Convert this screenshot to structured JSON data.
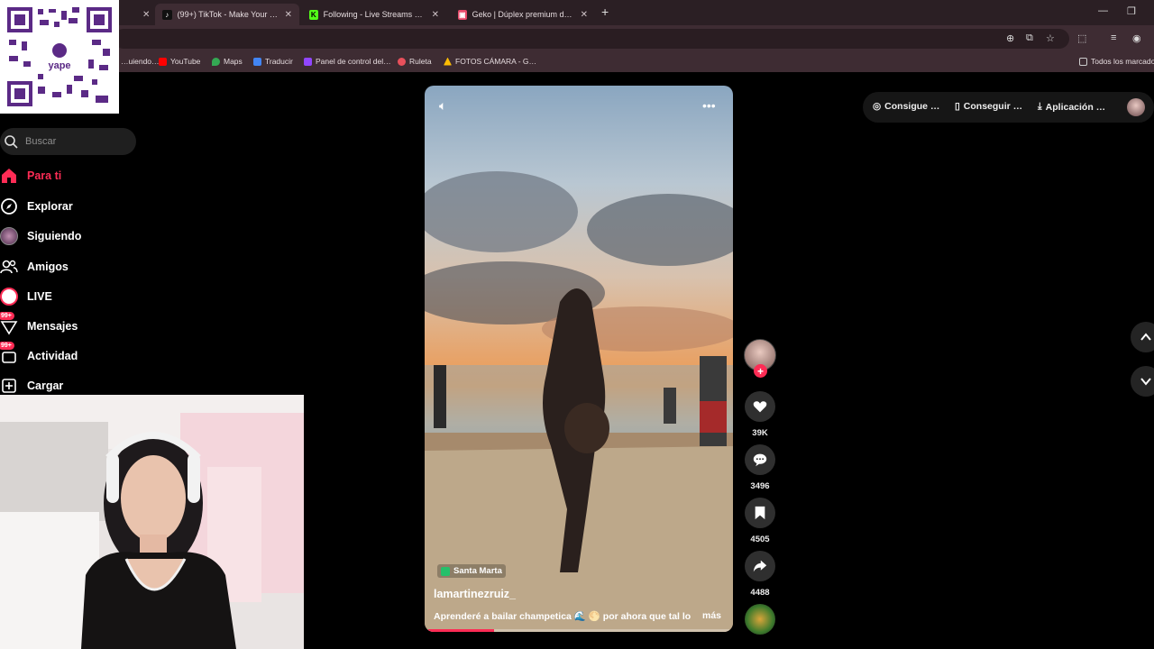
{
  "browser": {
    "tabs": [
      {
        "label": "(99+) TikTok - Make Your D…",
        "active": true
      },
      {
        "label": "Following - Live Streams on Ki…"
      },
      {
        "label": "Geko | Dúplex premium de 2 d…"
      }
    ],
    "bookmarks": [
      "…uiendo…",
      "YouTube",
      "Maps",
      "Traducir",
      "Panel de control del…",
      "Ruleta",
      "FOTOS CÁMARA - G…"
    ],
    "all_bookmarks_label": "Todos los marcados"
  },
  "qr": {
    "brand": "yape"
  },
  "sidebar": {
    "search_placeholder": "Buscar",
    "items": [
      {
        "label": "Para ti",
        "icon": "home-icon",
        "active": true
      },
      {
        "label": "Explorar",
        "icon": "compass-icon"
      },
      {
        "label": "Siguiendo",
        "icon": "following-avatar-icon"
      },
      {
        "label": "Amigos",
        "icon": "friends-icon"
      },
      {
        "label": "LIVE",
        "icon": "live-icon"
      },
      {
        "label": "Mensajes",
        "icon": "messages-icon",
        "badge": "99+"
      },
      {
        "label": "Actividad",
        "icon": "activity-icon",
        "badge": "99+"
      },
      {
        "label": "Cargar",
        "icon": "upload-icon"
      }
    ]
  },
  "video": {
    "location": "Santa Marta",
    "username": "lamartinezruiz_",
    "caption": "Aprenderé a bailar champetica 🌊 🌕 por ahora que tal lo",
    "more_label": "más",
    "progress": 0.22
  },
  "actions": {
    "likes": "39K",
    "comments": "3496",
    "saves": "4505",
    "shares": "4488"
  },
  "topbar": {
    "coins_label": "Consigue …",
    "app_label": "Conseguir …",
    "download_label": "Aplicación …"
  },
  "colors": {
    "accent": "#fe2c55",
    "chrome": "#3e2c33"
  }
}
